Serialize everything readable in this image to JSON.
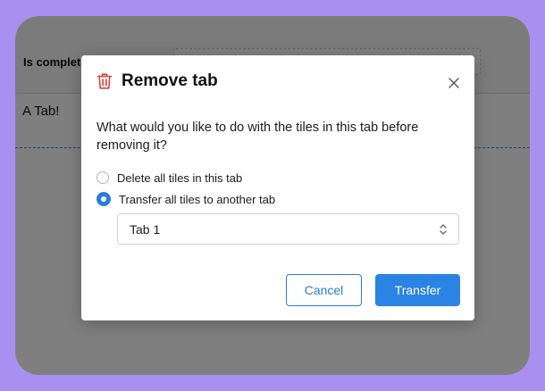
{
  "background": {
    "column_header": "Is complete",
    "tab_content": "A Tab!"
  },
  "dialog": {
    "title": "Remove tab",
    "question": "What would you like to do with the tiles in this tab before removing it?",
    "options": [
      {
        "label": "Delete all tiles in this tab",
        "selected": false
      },
      {
        "label": "Transfer all tiles to another tab",
        "selected": true
      }
    ],
    "select": {
      "value": "Tab 1"
    },
    "cancel_label": "Cancel",
    "confirm_label": "Transfer"
  },
  "colors": {
    "accent": "#2b84e3",
    "danger_icon": "#e0413a",
    "page_background": "#a98ff0"
  },
  "icons": {
    "title": "trash-icon",
    "close": "close-icon",
    "select": "chevron-up-down-icon"
  }
}
